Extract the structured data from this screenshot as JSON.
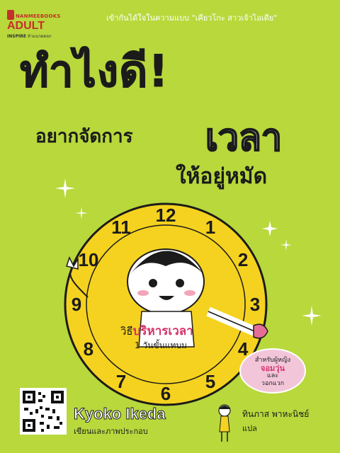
{
  "publisher": {
    "name": "NANMEEBOOKS",
    "line": "ADULT",
    "imprint": "INSPIRE",
    "imprint_thai": "ห้ามนวดดอก"
  },
  "tagline": "เข้ากันได้ใจในความแบบ \"เคียวโกะ สาวเจ้าไอเดีย\"",
  "title": {
    "main": "ทำไงดี!",
    "line2": "อยากจัดการ",
    "big": "เวลา",
    "line3": "ให้อยู่หมัด"
  },
  "clock": {
    "numbers": [
      "12",
      "1",
      "2",
      "3",
      "4",
      "5",
      "6",
      "7",
      "8",
      "9",
      "10",
      "11"
    ]
  },
  "method": {
    "prefix": "วิธี",
    "highlight": "บริหารเวลา",
    "sub": "1 วันขั้นแทบม"
  },
  "bubble": {
    "line1": "สำหรับผู้หญิง",
    "line2": "จอมวุ่น",
    "line3": "และ",
    "line4": "วอกแวก"
  },
  "author": {
    "name": "Kyoko Ikeda",
    "role": "เขียนและภาพประกอบ"
  },
  "translator": {
    "name": "ทินภาส พาหะนิชย์",
    "role": "แปล"
  },
  "colors": {
    "background": "#b8d83c",
    "clock_face": "#f5d21f",
    "accent_pink": "#d6336c",
    "publisher_red": "#c3312a"
  }
}
